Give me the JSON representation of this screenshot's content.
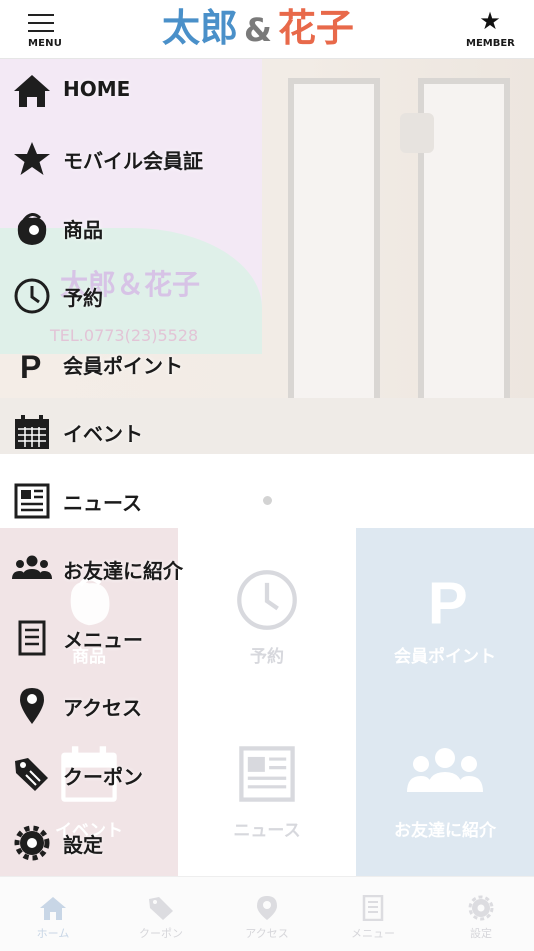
{
  "header": {
    "menu_label": "MENU",
    "logo": {
      "part1": "太郎",
      "amp": "&",
      "part2": "花子"
    },
    "member_label": "MEMBER"
  },
  "hero": {
    "sign_title": "太郎＆花子",
    "sign_tel": "TEL.0773(23)5528"
  },
  "tiles": [
    {
      "label": "商品",
      "icon": "bag-icon"
    },
    {
      "label": "予約",
      "icon": "clock-icon"
    },
    {
      "label": "会員ポイント",
      "icon": "p-icon"
    },
    {
      "label": "イベント",
      "icon": "calendar-icon"
    },
    {
      "label": "ニュース",
      "icon": "newspaper-icon"
    },
    {
      "label": "お友達に紹介",
      "icon": "people-icon"
    }
  ],
  "drawer": [
    {
      "label": "HOME",
      "icon": "home-icon"
    },
    {
      "label": "モバイル会員証",
      "icon": "star-icon"
    },
    {
      "label": "商品",
      "icon": "bag-icon"
    },
    {
      "label": "予約",
      "icon": "clock-icon"
    },
    {
      "label": "会員ポイント",
      "icon": "p-icon"
    },
    {
      "label": "イベント",
      "icon": "calendar-icon"
    },
    {
      "label": "ニュース",
      "icon": "newspaper-icon"
    },
    {
      "label": "お友達に紹介",
      "icon": "people-icon"
    },
    {
      "label": "メニュー",
      "icon": "list-icon"
    },
    {
      "label": "アクセス",
      "icon": "map-pin-icon"
    },
    {
      "label": "クーポン",
      "icon": "tag-icon"
    },
    {
      "label": "設定",
      "icon": "gear-icon"
    }
  ],
  "tabbar": [
    {
      "label": "ホーム",
      "icon": "home-icon",
      "active": true
    },
    {
      "label": "クーポン",
      "icon": "tag-icon"
    },
    {
      "label": "アクセス",
      "icon": "map-pin-icon"
    },
    {
      "label": "メニュー",
      "icon": "list-icon"
    },
    {
      "label": "設定",
      "icon": "gear-icon"
    }
  ],
  "colors": {
    "logo_blue": "#4a90c9",
    "logo_orange": "#e8694a",
    "tile_pink": "#f1e4e6",
    "tile_blue": "#dee8f1"
  }
}
